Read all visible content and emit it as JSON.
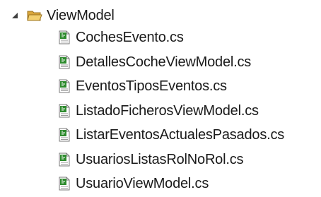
{
  "tree": {
    "folder": {
      "label": "ViewModel",
      "expanded": true,
      "icon": "open-folder-icon",
      "expander_icon": "expanded-triangle-icon"
    },
    "files": [
      {
        "label": "CochesEvento.cs",
        "icon": "csharp-file-icon"
      },
      {
        "label": "DetallesCocheViewModel.cs",
        "icon": "csharp-file-icon"
      },
      {
        "label": "EventosTiposEventos.cs",
        "icon": "csharp-file-icon"
      },
      {
        "label": "ListadoFicherosViewModel.cs",
        "icon": "csharp-file-icon"
      },
      {
        "label": "ListarEventosActualesPasados.cs",
        "icon": "csharp-file-icon"
      },
      {
        "label": "UsuariosListasRolNoRol.cs",
        "icon": "csharp-file-icon"
      },
      {
        "label": "UsuarioViewModel.cs",
        "icon": "csharp-file-icon"
      }
    ]
  },
  "colors": {
    "background": "#ffffff",
    "text": "#1a1a1a",
    "folder": "#e8b94a",
    "file_icon_green": "#2e8b2e"
  }
}
